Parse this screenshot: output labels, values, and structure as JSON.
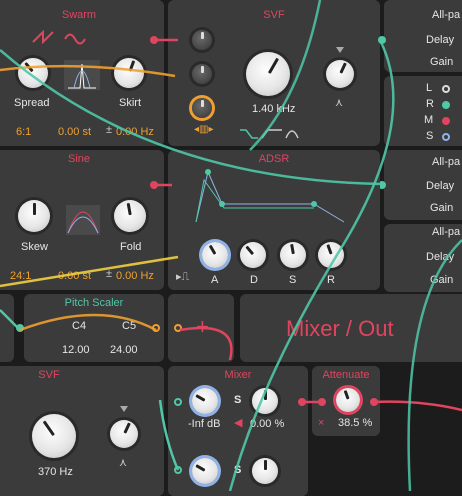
{
  "swarm": {
    "title": "Swarm",
    "spread_label": "Spread",
    "skirt_label": "Skirt",
    "ratio": "6:1",
    "semitones": "0.00 st",
    "hz_sign": "±",
    "hz": "0.00 Hz"
  },
  "sine": {
    "title": "Sine",
    "skew_label": "Skew",
    "fold_label": "Fold",
    "ratio": "24:1",
    "semitones": "0.00 st",
    "hz_sign": "±",
    "hz": "0.00 Hz"
  },
  "svf_top": {
    "title": "SVF",
    "freq": "1.40 kHz"
  },
  "adsr": {
    "title": "ADSR",
    "a": "A",
    "d": "D",
    "s": "S",
    "r": "R"
  },
  "allpass": [
    {
      "title": "All-pa",
      "delay": "Delay",
      "gain": "Gain"
    },
    {
      "title": "All-pa",
      "delay": "Delay",
      "gain": "Gain"
    },
    {
      "title": "All-pa",
      "delay": "Delay",
      "gain": "Gain"
    }
  ],
  "lrms": {
    "l": "L",
    "r": "R",
    "m": "M",
    "s": "S"
  },
  "pitch_scaler": {
    "title": "Pitch Scaler",
    "note1": "C4",
    "note2": "C5",
    "val1": "12.00",
    "val2": "24.00"
  },
  "plus": "+",
  "mixer_out": "Mixer / Out",
  "svf_bottom": {
    "title": "SVF",
    "freq": "370 Hz"
  },
  "mixer": {
    "title": "Mixer",
    "level": "-Inf dB",
    "s_label": "S",
    "pct": "0.00 %"
  },
  "attenuate": {
    "title": "Attenuate",
    "value": "38.5 %",
    "x": "×"
  },
  "colors": {
    "accent": "#e0455f",
    "teal": "#4fc8a8",
    "orange": "#f0a030",
    "panel": "#3b3b3b"
  }
}
